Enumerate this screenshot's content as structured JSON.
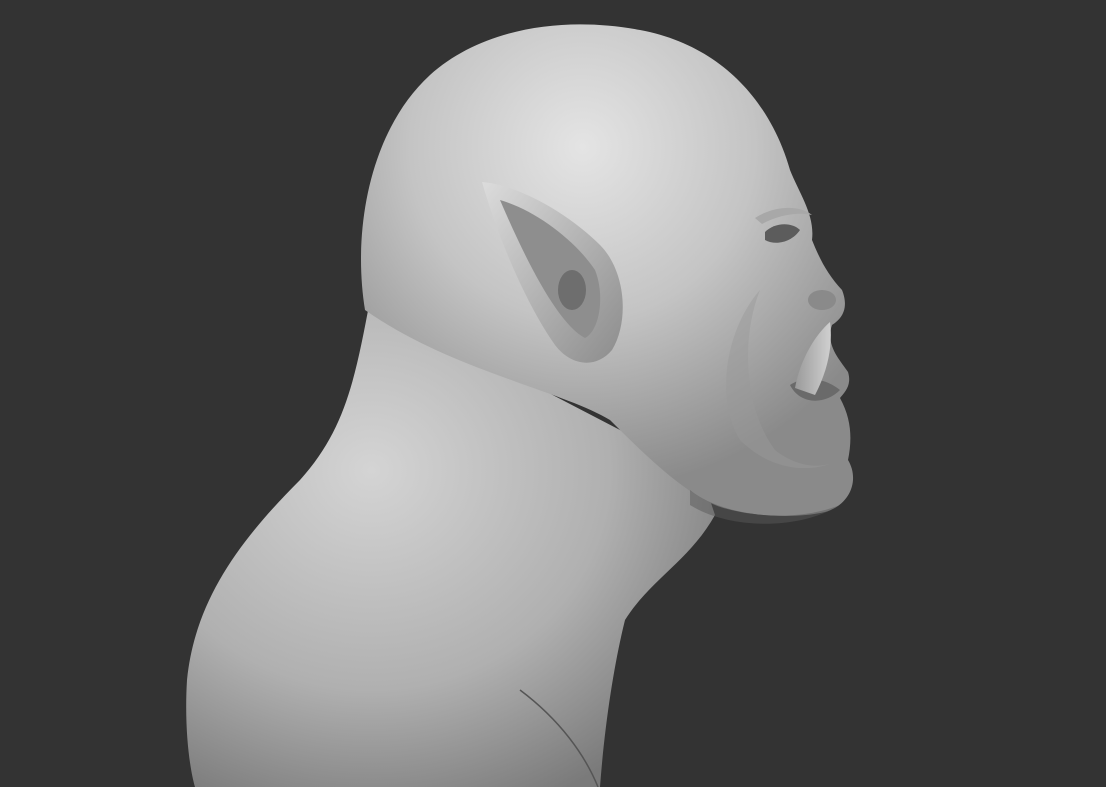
{
  "scene": {
    "subject": "orc-bust-sculpt",
    "background_color": "#333333",
    "material_color": "#c8c8c8",
    "highlight_color": "#e6e6e6",
    "shadow_color": "#6a6a6a"
  }
}
